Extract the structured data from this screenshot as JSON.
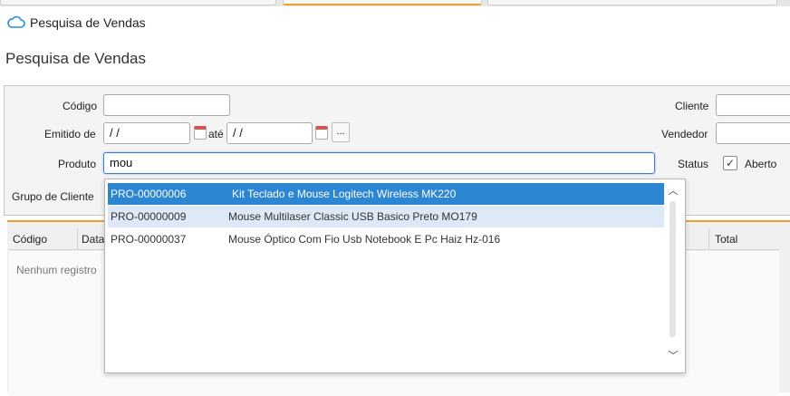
{
  "window": {
    "title": "Pesquisa de Vendas",
    "icon": "cloud-icon"
  },
  "page": {
    "title": "Pesquisa de Vendas"
  },
  "form": {
    "codigo_label": "Código",
    "codigo_value": "",
    "emitido_label": "Emitido de",
    "date_from": " /  /",
    "ate_label": "até",
    "date_to": " /  /",
    "produto_label": "Produto",
    "produto_value": "mou",
    "grupo_label": "Grupo de Cliente",
    "cliente_label": "Cliente",
    "cliente_value": "",
    "vendedor_label": "Vendedor",
    "vendedor_value": "",
    "status_label": "Status",
    "aberto_label": "Aberto",
    "aberto_checked": true,
    "ellipsis": "..."
  },
  "grid": {
    "columns": [
      "Código",
      "Data",
      "Total"
    ],
    "empty_text": "Nenhum registro"
  },
  "autocomplete": {
    "selected_index": 0,
    "hover_index": 1,
    "options": [
      {
        "code": "PRO-00000006",
        "description": "Kit Teclado e Mouse Logitech Wireless MK220"
      },
      {
        "code": "PRO-00000009",
        "description": "Mouse Multilaser Classic USB Basico Preto MO179"
      },
      {
        "code": "PRO-00000037",
        "description": "Mouse Óptico Com Fio Usb Notebook E Pc Haiz Hz-016"
      }
    ]
  },
  "colors": {
    "accent": "#f0a030",
    "selection": "#2d86d2",
    "hover": "#dde9f7",
    "brand_icon": "#2a8fd6"
  }
}
